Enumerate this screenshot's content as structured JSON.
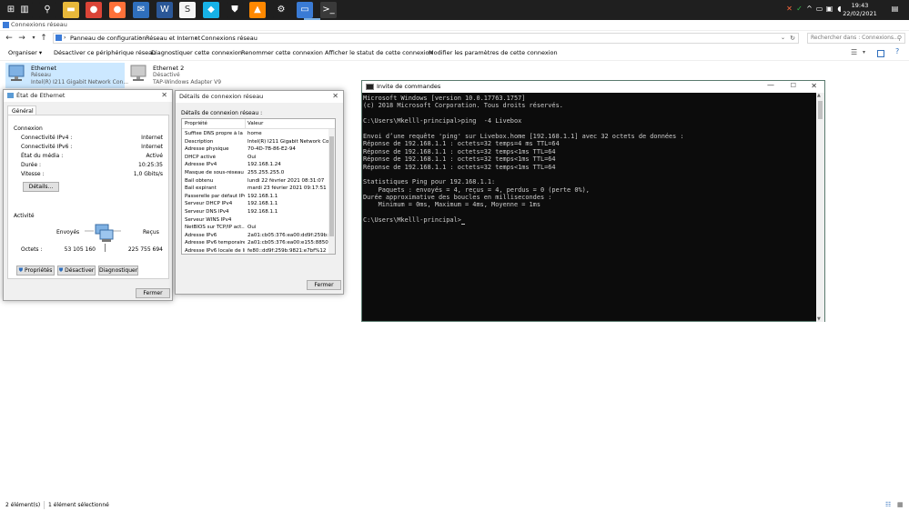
{
  "taskbar": {
    "start": "⊞",
    "clock_time": "19:43",
    "clock_date": "22/02/2021",
    "icons": [
      {
        "name": "task-view-icon",
        "glyph": "▥",
        "color": "#1f1f1f"
      },
      {
        "name": "search-icon",
        "glyph": "⚲",
        "color": "#1f1f1f"
      },
      {
        "name": "file-explorer-icon",
        "glyph": "▬",
        "color": "#e8b83a"
      },
      {
        "name": "chrome-icon",
        "glyph": "●",
        "color": "#db4437"
      },
      {
        "name": "firefox-icon",
        "glyph": "●",
        "color": "#ff7139"
      },
      {
        "name": "mail-icon",
        "glyph": "✉",
        "color": "#2f6fbd"
      },
      {
        "name": "word-icon",
        "glyph": "W",
        "color": "#2b5797"
      },
      {
        "name": "sublime-icon",
        "glyph": "S",
        "color": "#f5f5f5"
      },
      {
        "name": "kodi-icon",
        "glyph": "◆",
        "color": "#17b2e7"
      },
      {
        "name": "security-icon",
        "glyph": "⛊",
        "color": "#1f1f1f"
      },
      {
        "name": "vlc-icon",
        "glyph": "▲",
        "color": "#ff8800"
      },
      {
        "name": "settings-icon",
        "glyph": "⚙",
        "color": "#1f1f1f"
      },
      {
        "name": "remote-desktop-icon",
        "glyph": "▭",
        "color": "#3a7bd5"
      },
      {
        "name": "terminal-icon",
        "glyph": ">_",
        "color": "#3a3a3a"
      }
    ]
  },
  "explorer": {
    "title": "Connexions réseau",
    "breadcrumb": [
      "Panneau de configuration",
      "Réseau et Internet",
      "Connexions réseau"
    ],
    "search_placeholder": "Rechercher dans : Connexions...",
    "commands": [
      "Organiser ▾",
      "Désactiver ce périphérique réseau",
      "Diagnostiquer cette connexion",
      "Renommer cette connexion",
      "Afficher le statut de cette connexion",
      "Modifier les paramètres de cette connexion"
    ],
    "adapters": [
      {
        "name": "Ethernet",
        "status": "Réseau",
        "device": "Intel(R) I211 Gigabit Network Con..."
      },
      {
        "name": "Ethernet 2",
        "status": "Désactivé",
        "device": "TAP-Windows Adapter V9"
      }
    ],
    "status_items": "2 élément(s)",
    "status_selected": "1 élément sélectionné"
  },
  "status_dialog": {
    "title": "État de Ethernet",
    "tab": "Général",
    "section_connection": "Connexion",
    "fields": [
      {
        "label": "Connectivité IPv4 :",
        "value": "Internet"
      },
      {
        "label": "Connectivité IPv6 :",
        "value": "Internet"
      },
      {
        "label": "État du média :",
        "value": "Activé"
      },
      {
        "label": "Durée :",
        "value": "10:25:35"
      },
      {
        "label": "Vitesse :",
        "value": "1,0 Gbits/s"
      }
    ],
    "details_button": "Détails...",
    "section_activity": "Activité",
    "sent_label": "Envoyés",
    "received_label": "Reçus",
    "octets_label": "Octets :",
    "octets_sent": "53 105 160",
    "octets_received": "225 755 694",
    "buttons": [
      "Propriétés",
      "Désactiver",
      "Diagnostiquer"
    ],
    "close_button": "Fermer"
  },
  "details_dialog": {
    "title": "Détails de connexion réseau",
    "caption": "Détails de connexion réseau :",
    "col_property": "Propriété",
    "col_value": "Valeur",
    "rows": [
      {
        "k": "Suffixe DNS propre à la ...",
        "v": "home"
      },
      {
        "k": "Description",
        "v": "Intel(R) I211 Gigabit Network Connect"
      },
      {
        "k": "Adresse physique",
        "v": "70-4D-7B-86-E2-94"
      },
      {
        "k": "DHCP activé",
        "v": "Oui"
      },
      {
        "k": "Adresse IPv4",
        "v": "192.168.1.24"
      },
      {
        "k": "Masque de sous-réseau ...",
        "v": "255.255.255.0"
      },
      {
        "k": "Bail obtenu",
        "v": "lundi 22 février 2021 08:31:07"
      },
      {
        "k": "Bail expirant",
        "v": "mardi 23 février 2021 09:17:51"
      },
      {
        "k": "Passerelle par défaut IPv4",
        "v": "192.168.1.1"
      },
      {
        "k": "Serveur DHCP IPv4",
        "v": "192.168.1.1"
      },
      {
        "k": "Serveur DNS IPv4",
        "v": "192.168.1.1"
      },
      {
        "k": "Serveur WINS IPv4",
        "v": ""
      },
      {
        "k": "NetBIOS sur TCP/IP act...",
        "v": "Oui"
      },
      {
        "k": "Adresse IPv6",
        "v": "2a01:cb05:376:ea00:dd9f:259b:9821"
      },
      {
        "k": "Adresse IPv6 temporaire",
        "v": "2a01:cb05:376:ea00:e155:8850:e47f"
      },
      {
        "k": "Adresse IPv6 locale de li...",
        "v": "fe80::dd9f:259b:9821:e7bf%12"
      }
    ],
    "close_button": "Fermer"
  },
  "console": {
    "title": "Invite de commandes",
    "lines": [
      "Microsoft Windows [version 10.0.17763.1757]",
      "(c) 2018 Microsoft Corporation. Tous droits réservés.",
      "",
      "C:\\Users\\Mkelll-principal>ping  -4 Livebox",
      "",
      "Envoi d’une requête 'ping' sur Livebox.home [192.168.1.1] avec 32 octets de données :",
      "Réponse de 192.168.1.1 : octets=32 temps=4 ms TTL=64",
      "Réponse de 192.168.1.1 : octets=32 temps<1ms TTL=64",
      "Réponse de 192.168.1.1 : octets=32 temps<1ms TTL=64",
      "Réponse de 192.168.1.1 : octets=32 temps<1ms TTL=64",
      "",
      "Statistiques Ping pour 192.168.1.1:",
      "    Paquets : envoyés = 4, reçus = 4, perdus = 0 (perte 0%),",
      "Durée approximative des boucles en millisecondes :",
      "    Minimum = 0ms, Maximum = 4ms, Moyenne = 1ms",
      "",
      "C:\\Users\\Mkelll-principal>"
    ]
  }
}
